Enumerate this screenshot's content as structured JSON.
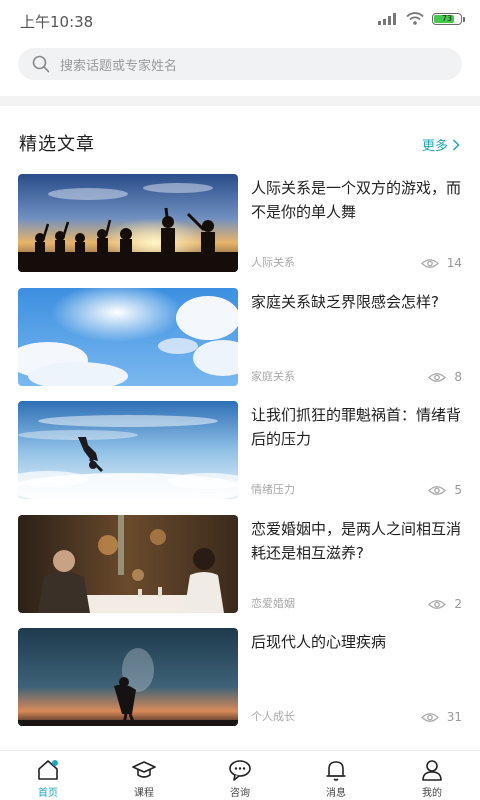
{
  "status_bar": {
    "time": "上午10:38",
    "battery": "73"
  },
  "search": {
    "placeholder": "搜索话题或专家姓名"
  },
  "section": {
    "title": "精选文章",
    "more_label": "更多"
  },
  "articles": [
    {
      "title": "人际关系是一个双方的游戏，而不是你的单人舞",
      "tag": "人际关系",
      "views": "14"
    },
    {
      "title": "家庭关系缺乏界限感会怎样?",
      "tag": "家庭关系",
      "views": "8"
    },
    {
      "title": "让我们抓狂的罪魁祸首：情绪背后的压力",
      "tag": "情绪压力",
      "views": "5"
    },
    {
      "title": "恋爱婚姻中，是两人之间相互消耗还是相互滋养?",
      "tag": "恋爱婚姻",
      "views": "2"
    },
    {
      "title": "后现代人的心理疾病",
      "tag": "个人成长",
      "views": "31"
    }
  ],
  "tabbar": {
    "active_color": "#1ea5b8",
    "items": [
      {
        "label": "首页",
        "icon": "home-icon"
      },
      {
        "label": "课程",
        "icon": "graduation-cap-icon"
      },
      {
        "label": "咨询",
        "icon": "chat-bubble-icon"
      },
      {
        "label": "消息",
        "icon": "bell-icon"
      },
      {
        "label": "我的",
        "icon": "user-icon"
      }
    ]
  }
}
